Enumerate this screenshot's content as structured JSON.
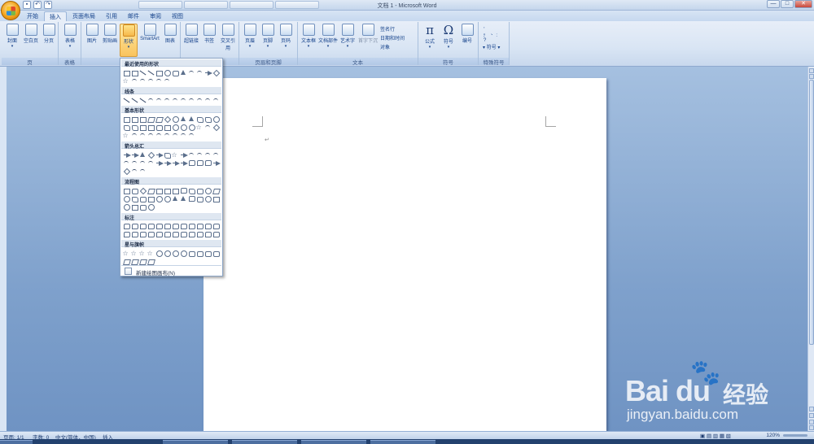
{
  "window": {
    "title": "文档 1 - Microsoft Word",
    "controls": [
      "—",
      "□",
      "✕"
    ]
  },
  "ribbon_tabs": [
    {
      "label": "开始",
      "active": false
    },
    {
      "label": "插入",
      "active": true
    },
    {
      "label": "页面布局",
      "active": false
    },
    {
      "label": "引用",
      "active": false
    },
    {
      "label": "邮件",
      "active": false
    },
    {
      "label": "审阅",
      "active": false
    },
    {
      "label": "视图",
      "active": false
    }
  ],
  "groups": {
    "pages": {
      "title": "页",
      "buttons": [
        "封面",
        "空白页",
        "分页"
      ]
    },
    "tables": {
      "title": "表格",
      "buttons": [
        "表格"
      ]
    },
    "illustrations": {
      "title": "",
      "buttons": [
        "图片",
        "剪贴画",
        "形状",
        "SmartArt",
        "图表"
      ]
    },
    "links": {
      "title": "",
      "buttons": [
        "超链接",
        "书签",
        "交叉引用"
      ]
    },
    "header_footer": {
      "title": "页眉和页脚",
      "buttons": [
        "页眉",
        "页脚",
        "页码"
      ]
    },
    "text": {
      "title": "文本",
      "buttons": [
        "文本框",
        "文档部件",
        "艺术字",
        "首字下沉"
      ],
      "small": [
        "签名行",
        "日期和时间",
        "对象"
      ]
    },
    "symbols": {
      "title": "符号",
      "buttons": [
        "公式",
        "符号",
        "编号"
      ]
    },
    "special": {
      "title": "特殊符号",
      "small": [
        "符号"
      ]
    }
  },
  "shapes_menu": {
    "sections": [
      "最近使用的形状",
      "线条",
      "基本形状",
      "箭头总汇",
      "流程图",
      "标注",
      "星与旗帜"
    ],
    "new_canvas": "新建绘图画布(N)"
  },
  "document": {
    "paragraph_mark": "↵"
  },
  "statusbar": {
    "page": "页面: 1/1",
    "words": "字数: 0",
    "language": "中文(简体，中国)",
    "mode": "插入",
    "zoom": "120%"
  },
  "watermark": {
    "logo": "Bai du",
    "paw": "🐾",
    "cn": "经验",
    "url": "jingyan.baidu.com"
  },
  "colors": {
    "ribbon_blue": "#15428b",
    "doc_background": "#7fa1cc",
    "active_button": "#f9c45e"
  }
}
